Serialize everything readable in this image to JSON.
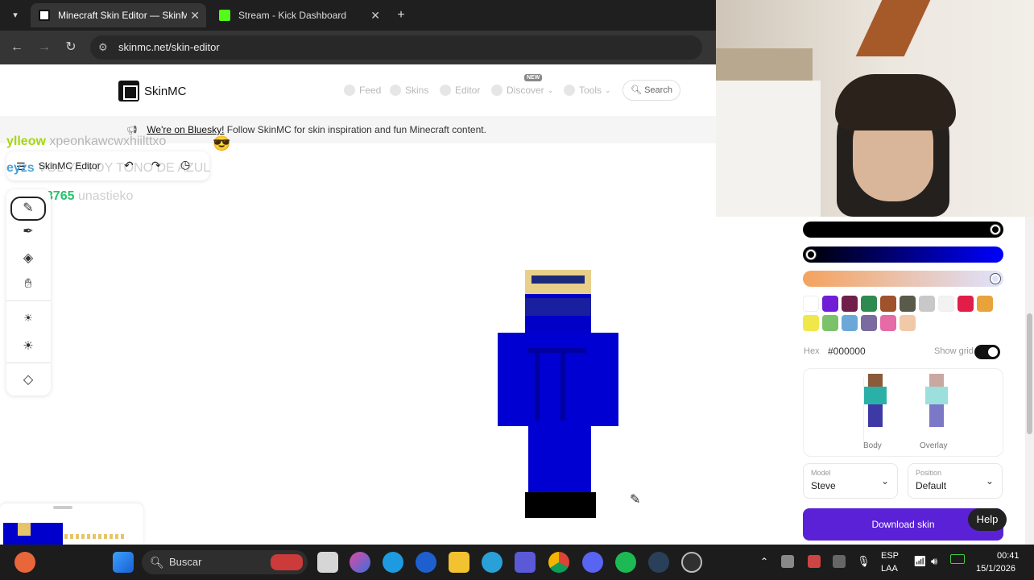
{
  "browser": {
    "tabs": [
      {
        "title": "Minecraft Skin Editor — SkinMC",
        "active": true
      },
      {
        "title": "Stream - Kick Dashboard",
        "active": false
      }
    ],
    "new_tab": "+",
    "url": "skinmc.net/skin-editor"
  },
  "site": {
    "logo": "SkinMC",
    "nav": [
      {
        "label": "Feed"
      },
      {
        "label": "Skins"
      },
      {
        "label": "Editor"
      },
      {
        "label": "Discover",
        "badge": "NEW"
      },
      {
        "label": "Tools"
      }
    ],
    "search_label": "Search",
    "banner_link": "We're on Bluesky!",
    "banner_text": "Follow SkinMC for skin inspiration and fun Minecraft content."
  },
  "chat_overlay": [
    {
      "user": "ylleow",
      "message": "xpeonkawcwxhiilttxo",
      "color": "#a6d610"
    },
    {
      "user": "eyzs",
      "message": "VOL YA VOY TONO DE AZUL",
      "color": "#4fa3d9"
    },
    {
      "user": "Aqus98765",
      "message": "unastieko",
      "color": "#25c46a"
    }
  ],
  "editor": {
    "title": "SkinMC Editor",
    "tools": [
      "pen-tool",
      "eyedropper",
      "bucket",
      "hand",
      "brightness-low",
      "brightness-high",
      "eraser"
    ]
  },
  "panel": {
    "slider_colors": [
      "#000000",
      "#0000ff",
      "#f5a25d"
    ],
    "palette": [
      "#ffffff",
      "#6f1ed6",
      "#6f1f4a",
      "#2e8b4f",
      "#a0522d",
      "#5a5a4a",
      "#c8c8c8",
      "#f2f2f2",
      "#e11d48",
      "#e8a33a",
      "#f0e84a",
      "#7cc26a",
      "#6ba8d8",
      "#7a6aa0",
      "#e56aa6",
      "#f2c9a8"
    ],
    "hex_label": "Hex",
    "hex_value": "#000000",
    "show_grid_label": "Show grid",
    "show_grid": true,
    "preview_body": "Body",
    "preview_overlay": "Overlay",
    "model_label": "Model",
    "model_value": "Steve",
    "position_label": "Position",
    "position_value": "Default",
    "download": "Download skin"
  },
  "help": "Help",
  "taskbar": {
    "search_placeholder": "Buscar",
    "lang_top": "ESP",
    "lang_bottom": "LAA",
    "time": "00:41",
    "date": "15/1/2026"
  }
}
